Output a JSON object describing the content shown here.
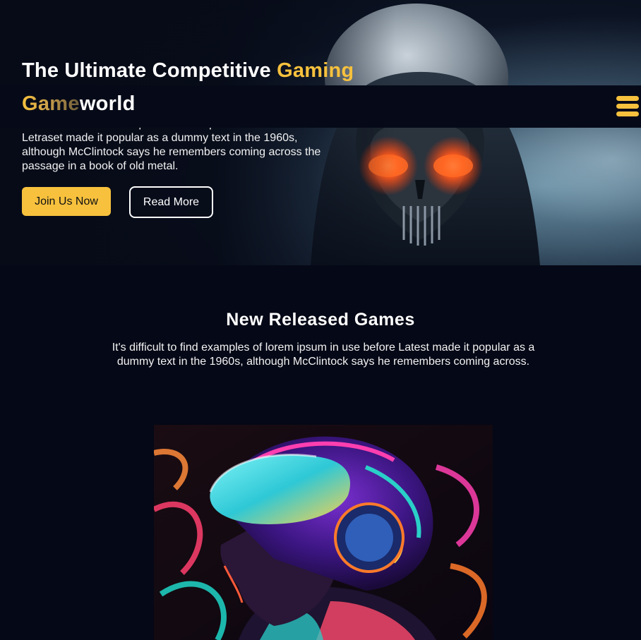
{
  "hero": {
    "title_main": "The Ultimate Competitive ",
    "title_accent": "Gaming",
    "description": "It's difficult to find examples of lorem ipsum in use before Letraset made it popular as a dummy text in the 1960s, although McClintock says he remembers coming across the passage in a book of old metal.",
    "primary_button": "Join Us Now",
    "secondary_button": "Read More"
  },
  "navbar": {
    "logo_part1": "Game",
    "logo_part2": "world",
    "menu_icon": "hamburger-menu-icon"
  },
  "new_releases": {
    "heading": "New Released Games",
    "description": "It's difficult to find examples of lorem ipsum in use before Latest made it popular as a dummy text in the 1960s, although McClintock says he remembers coming across."
  },
  "colors": {
    "background": "#050816",
    "accent": "#f7c13d",
    "text": "#ffffff"
  }
}
